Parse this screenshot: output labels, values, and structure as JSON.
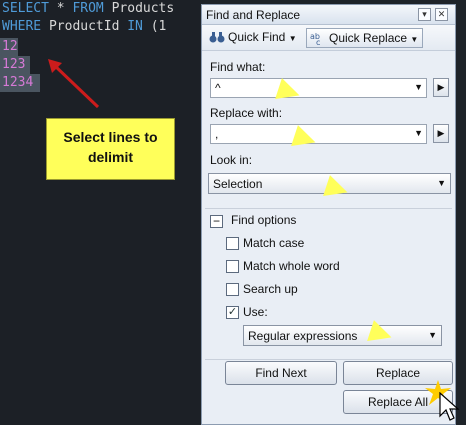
{
  "editor": {
    "line1": {
      "kw1": "SELECT",
      "rest": " * ",
      "kw2": "FROM",
      "rest2": " Products"
    },
    "line2": {
      "kw1": "WHERE",
      "rest": " ProductId ",
      "kw2": "IN",
      "rest2": " (1"
    },
    "selected_lines": [
      "12",
      "123",
      "1234"
    ]
  },
  "callout": {
    "line1": "Select lines to",
    "line2": "delimit"
  },
  "dialog": {
    "title": "Find and Replace",
    "pin_glyph": "▾",
    "close_glyph": "✕",
    "tabs": {
      "quick_find": "Quick Find",
      "quick_replace": "Quick Replace"
    },
    "find_label": "Find what:",
    "find_value": "^",
    "replace_label": "Replace with:",
    "replace_value": ",",
    "look_in_label": "Look in:",
    "look_in_value": "Selection",
    "options_title": "Find options",
    "options": [
      {
        "label": "Match case",
        "checked": false
      },
      {
        "label": "Match whole word",
        "checked": false
      },
      {
        "label": "Search up",
        "checked": false
      },
      {
        "label": "Use:",
        "checked": true
      }
    ],
    "use_value": "Regular expressions",
    "buttons": {
      "find_next": "Find Next",
      "replace": "Replace",
      "replace_all": "Replace All"
    }
  },
  "colors": {
    "editor_bg": "#1c2026",
    "keyword": "#4f9bd8",
    "selection": "#4a5560",
    "callout": "#ffff5a"
  }
}
